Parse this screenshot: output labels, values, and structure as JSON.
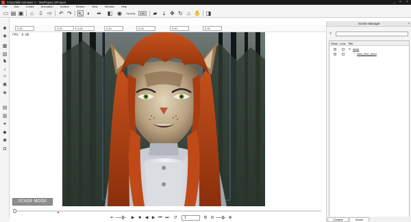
{
  "window": {
    "title": "CrazyTalk Animator 2 - \\NoProject.ctProject",
    "controls": [
      "_",
      "□",
      "×"
    ]
  },
  "menu": [
    "File",
    "Edit",
    "Create",
    "Animation",
    "Control",
    "Render",
    "View",
    "Window",
    "Help"
  ],
  "toolbar": {
    "icons": [
      "new-file-icon",
      "open-icon",
      "save-icon",
      "store-icon",
      "import-icon",
      "export-icon",
      "undo-icon",
      "redo-icon",
      "select-icon",
      "camera-icon",
      "flip-icon",
      "preview-icon",
      "view-icon",
      "record-icon",
      "move-icon",
      "scale-icon",
      "rotate-icon",
      "home-icon",
      "fit-icon"
    ],
    "opacity_label": "Opacity",
    "opacity_value": "100"
  },
  "keyframe_fields": [
    "0.00",
    "0.00",
    "0.00",
    "0.00",
    "0.00",
    "0.00",
    "0.00"
  ],
  "stage": {
    "fps_text": "FPS: 0.00",
    "mode_button": "STAGE MODE"
  },
  "playback": {
    "frame_value": "1"
  },
  "scene_manager": {
    "title": "Scene Manager",
    "columns": {
      "show": "Show",
      "lock": "Lock",
      "title": "Title"
    },
    "items": [
      {
        "label": "Actor",
        "show": true,
        "lock": false,
        "level": 0
      },
      {
        "label": "New_Bird_Actor",
        "show": true,
        "lock": false,
        "level": 1
      }
    ],
    "tabs": [
      "Content Manager",
      "Scene Manager"
    ]
  },
  "colors": {
    "hair": "#b34416",
    "fur": "#d7c7a8",
    "suit": "#e6e6ec",
    "forest": "#1d2520"
  }
}
